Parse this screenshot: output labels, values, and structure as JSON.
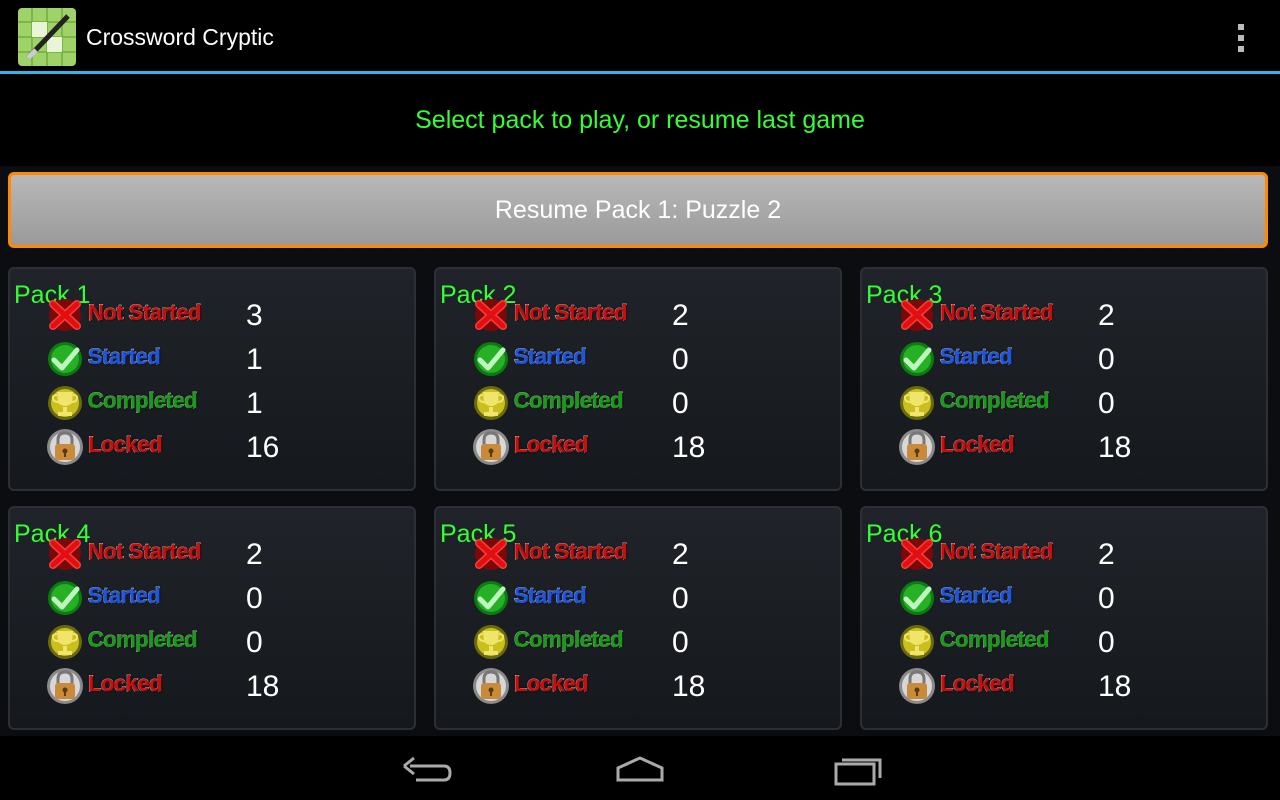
{
  "app": {
    "title": "Crossword Cryptic",
    "icon": "crossword-pen-icon"
  },
  "subtitle": "Select pack to play, or resume last game",
  "resume_label": "Resume Pack 1: Puzzle 2",
  "labels": {
    "not_started": "Not Started",
    "started": "Started",
    "completed": "Completed",
    "locked": "Locked"
  },
  "packs": [
    {
      "title": "Pack 1",
      "not_started": "3",
      "started": "1",
      "completed": "1",
      "locked": "16"
    },
    {
      "title": "Pack 2",
      "not_started": "2",
      "started": "0",
      "completed": "0",
      "locked": "18"
    },
    {
      "title": "Pack 3",
      "not_started": "2",
      "started": "0",
      "completed": "0",
      "locked": "18"
    },
    {
      "title": "Pack 4",
      "not_started": "2",
      "started": "0",
      "completed": "0",
      "locked": "18"
    },
    {
      "title": "Pack 5",
      "not_started": "2",
      "started": "0",
      "completed": "0",
      "locked": "18"
    },
    {
      "title": "Pack 6",
      "not_started": "2",
      "started": "0",
      "completed": "0",
      "locked": "18"
    }
  ],
  "colors": {
    "accent": "#33b5e5",
    "highlight": "#ff8a00",
    "title_green": "#33ff33"
  },
  "nav": {
    "back": "back-icon",
    "home": "home-icon",
    "recents": "recents-icon"
  }
}
